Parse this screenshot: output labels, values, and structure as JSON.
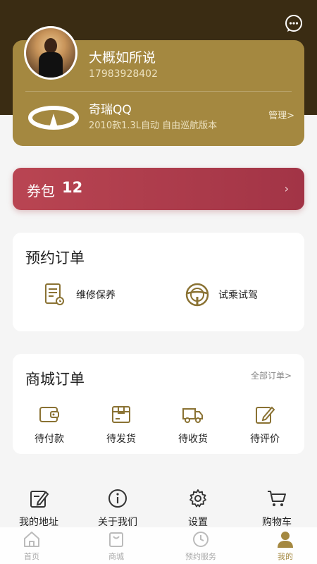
{
  "profile": {
    "name": "大概如所说",
    "phone": "17983928402"
  },
  "car": {
    "name": "奇瑞QQ",
    "desc": "2010款1.3L自动 自由巡航版本",
    "manage_label": "管理>"
  },
  "coupon": {
    "label": "券包",
    "count": "12",
    "arrow": "›"
  },
  "booking": {
    "title": "预约订单",
    "items": [
      {
        "label": "维修保养",
        "icon": "repair-document-icon"
      },
      {
        "label": "试乘试驾",
        "icon": "steering-wheel-icon"
      }
    ]
  },
  "mall": {
    "title": "商城订单",
    "all_label": "全部订单>",
    "items": [
      {
        "label": "待付款",
        "icon": "wallet-icon"
      },
      {
        "label": "待发货",
        "icon": "box-icon"
      },
      {
        "label": "待收货",
        "icon": "truck-icon"
      },
      {
        "label": "待评价",
        "icon": "edit-review-icon"
      }
    ]
  },
  "tools": [
    {
      "label": "我的地址",
      "icon": "address-edit-icon"
    },
    {
      "label": "关于我们",
      "icon": "info-icon"
    },
    {
      "label": "设置",
      "icon": "gear-icon"
    },
    {
      "label": "购物车",
      "icon": "cart-icon"
    }
  ],
  "tabs": [
    {
      "label": "首页",
      "icon": "home-icon"
    },
    {
      "label": "商城",
      "icon": "shop-bag-icon"
    },
    {
      "label": "预约服务",
      "icon": "clock-icon"
    },
    {
      "label": "我的",
      "icon": "user-icon"
    }
  ],
  "colors": {
    "header_bg": "#3a2c13",
    "card_gold": "#a48840",
    "coupon_red": "#b94552",
    "active_tab": "#a48840"
  }
}
